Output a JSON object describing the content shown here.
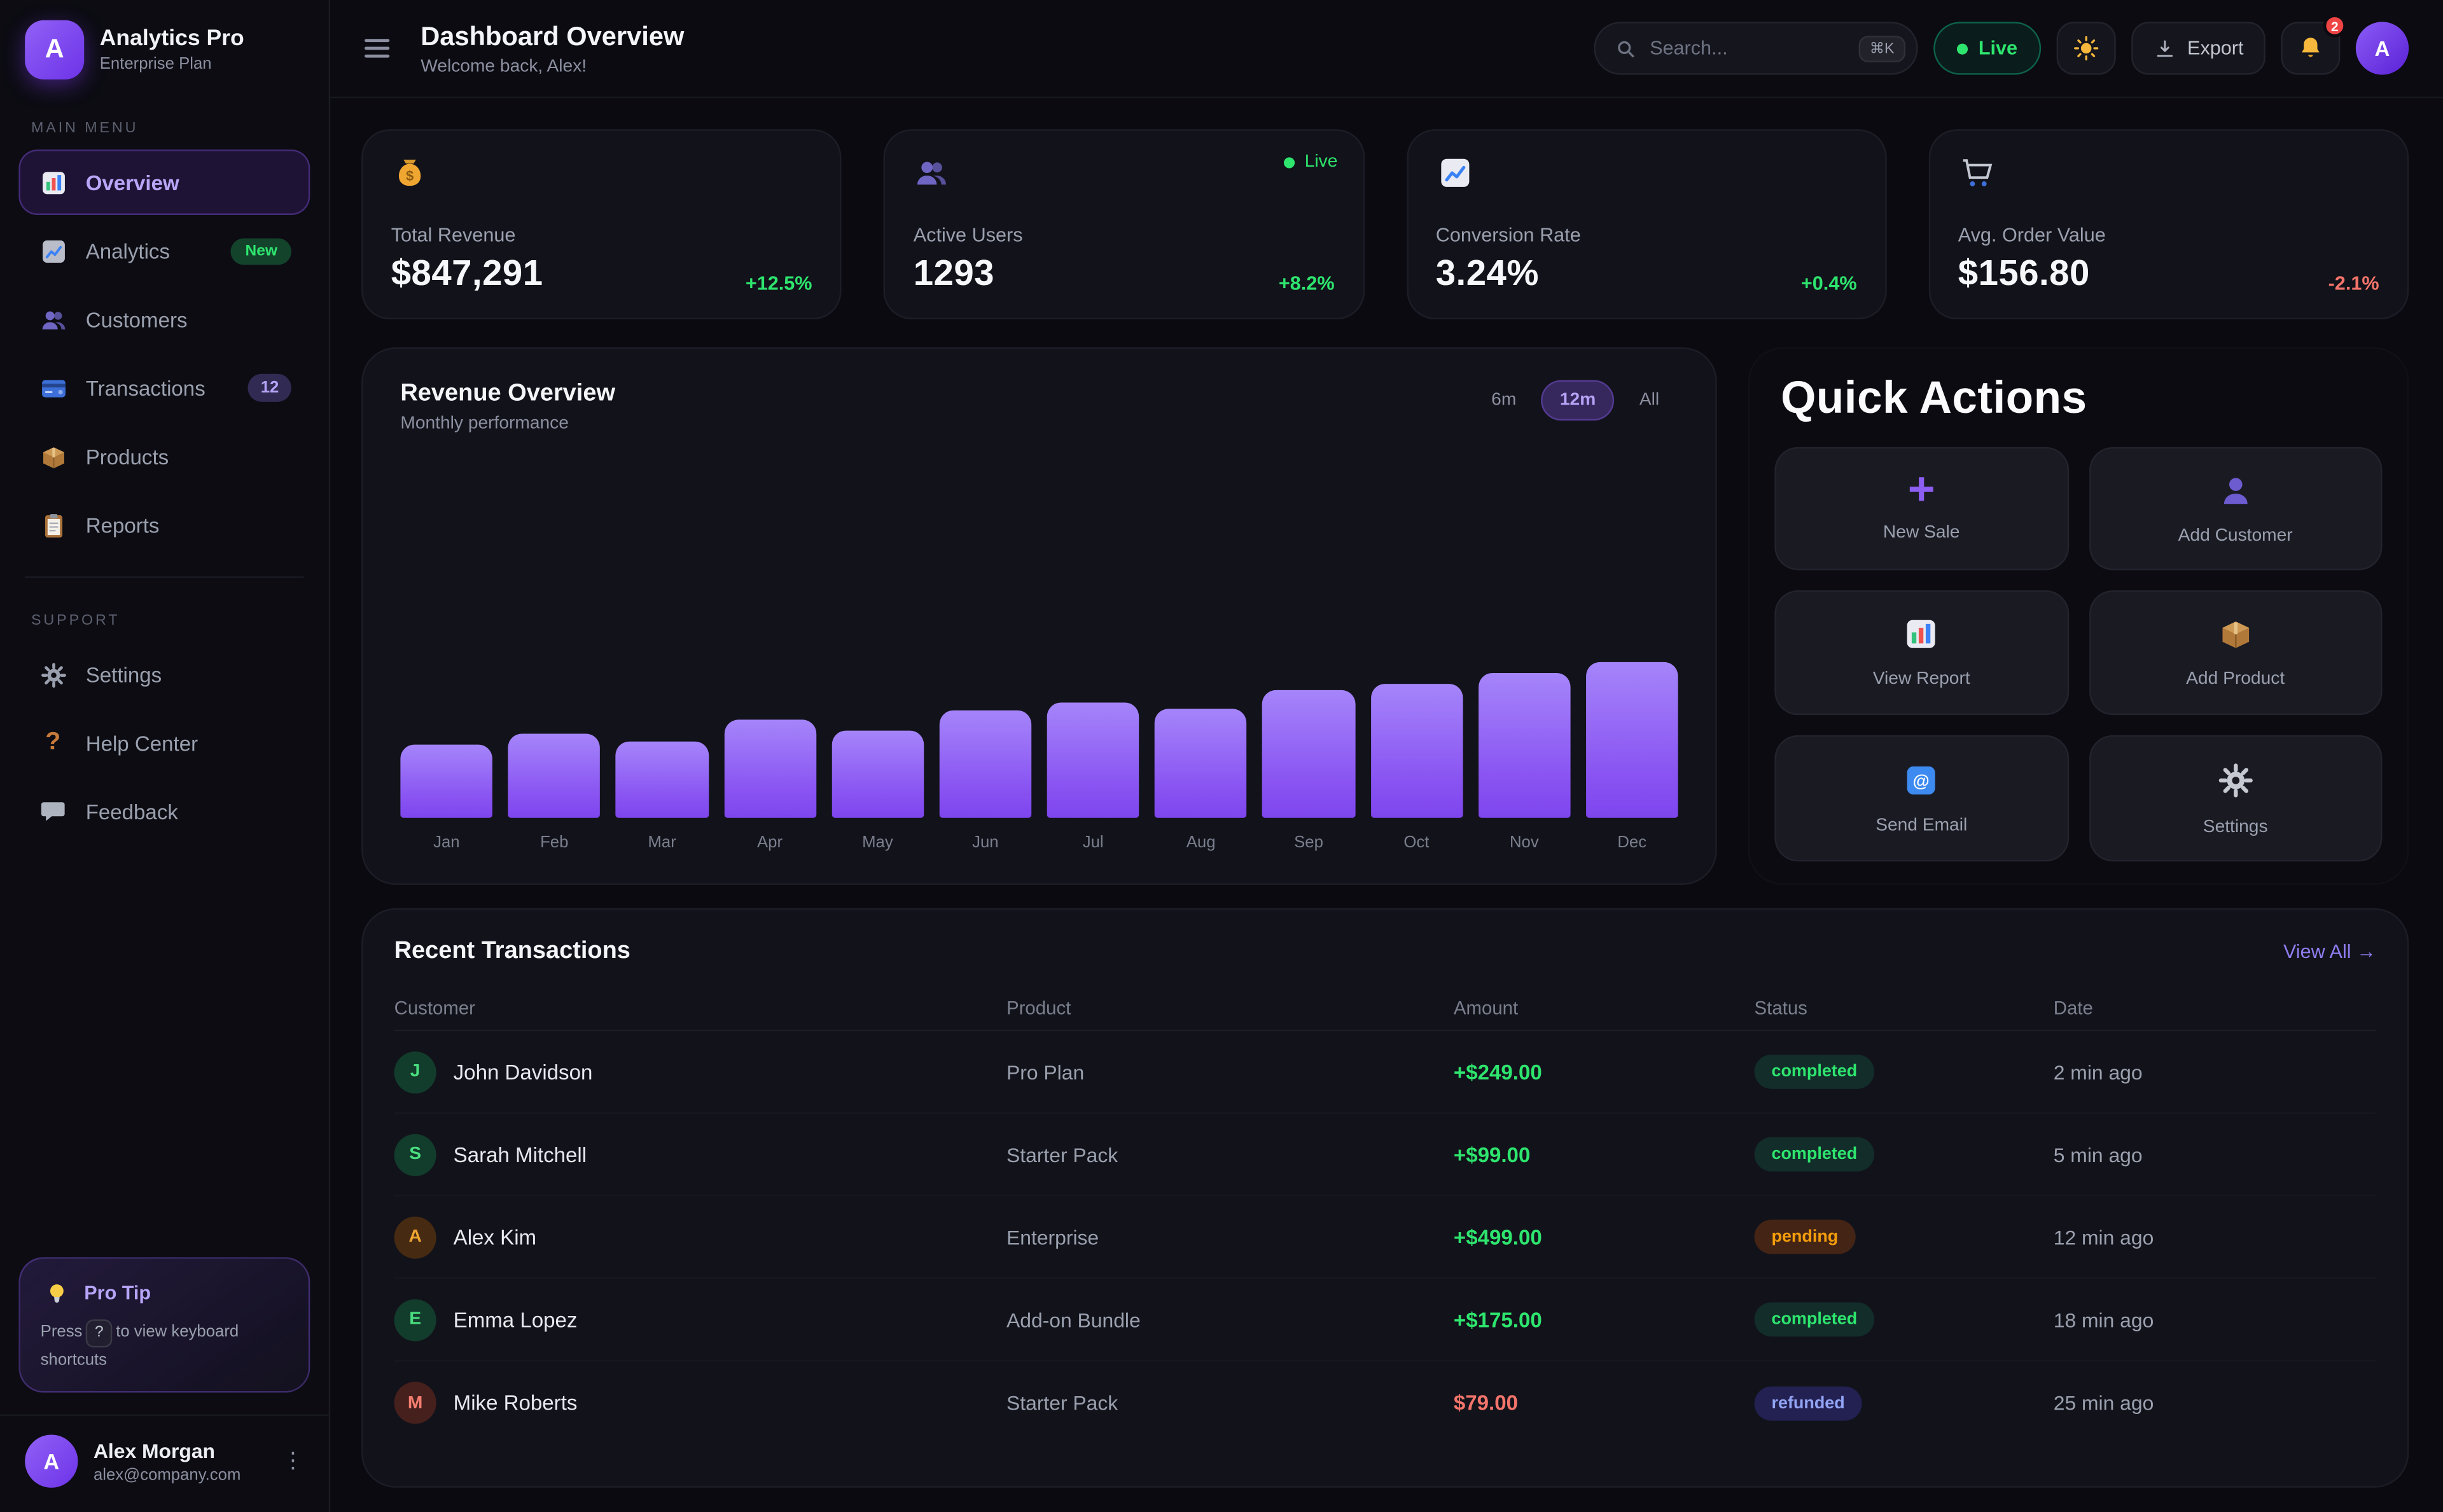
{
  "brand": {
    "initial": "A",
    "name": "Analytics Pro",
    "plan": "Enterprise Plan"
  },
  "sidebar": {
    "sections": [
      {
        "label": "MAIN MENU",
        "items": [
          {
            "label": "Overview",
            "icon": "bar-chart",
            "active": true
          },
          {
            "label": "Analytics",
            "icon": "chart-up",
            "badge": "New"
          },
          {
            "label": "Customers",
            "icon": "users"
          },
          {
            "label": "Transactions",
            "icon": "credit-card",
            "badge": "12"
          },
          {
            "label": "Products",
            "icon": "package"
          },
          {
            "label": "Reports",
            "icon": "clipboard"
          }
        ]
      },
      {
        "label": "SUPPORT",
        "items": [
          {
            "label": "Settings",
            "icon": "gear"
          },
          {
            "label": "Help Center",
            "icon": "question-mark"
          },
          {
            "label": "Feedback",
            "icon": "speech-bubble"
          }
        ]
      }
    ],
    "pro_tip": {
      "title": "Pro Tip",
      "icon": "lightbulb",
      "text_before": "Press",
      "key": "?",
      "text_after": "to view keyboard shortcuts"
    },
    "user": {
      "initial": "A",
      "name": "Alex Morgan",
      "email": "alex@company.com"
    }
  },
  "header": {
    "title": "Dashboard Overview",
    "subtitle": "Welcome back, Alex!",
    "search": {
      "placeholder": "Search...",
      "shortcut": "⌘K"
    },
    "live_label": "Live",
    "export_label": "Export",
    "notification_count": "2",
    "avatar_initial": "A"
  },
  "stats": [
    {
      "icon": "money-bag",
      "label": "Total Revenue",
      "value": "$847,291",
      "change": "+12.5%",
      "trend": "up"
    },
    {
      "icon": "users",
      "label": "Active Users",
      "value": "1293",
      "change": "+8.2%",
      "trend": "up",
      "live_badge": "Live"
    },
    {
      "icon": "chart-up",
      "label": "Conversion Rate",
      "value": "3.24%",
      "change": "+0.4%",
      "trend": "up"
    },
    {
      "icon": "cart",
      "label": "Avg. Order Value",
      "value": "$156.80",
      "change": "-2.1%",
      "trend": "down"
    }
  ],
  "revenue_panel": {
    "title": "Revenue Overview",
    "subtitle": "Monthly performance",
    "ranges": [
      {
        "label": "6m",
        "active": false
      },
      {
        "label": "12m",
        "active": true
      },
      {
        "label": "All",
        "active": false
      }
    ]
  },
  "chart_data": {
    "type": "bar",
    "title": "Revenue Overview",
    "subtitle": "Monthly performance",
    "categories": [
      "Jan",
      "Feb",
      "Mar",
      "Apr",
      "May",
      "Jun",
      "Jul",
      "Aug",
      "Sep",
      "Oct",
      "Nov",
      "Dec"
    ],
    "values": [
      47,
      54,
      49,
      63,
      56,
      69,
      74,
      70,
      82,
      86,
      93,
      100
    ],
    "units": "relative bar height %, no numeric y-axis shown",
    "xlabel": "",
    "ylabel": "",
    "grid": false,
    "legend": false,
    "bar_gradient": [
      "#a585fa",
      "#7e45ee"
    ]
  },
  "quick_actions": {
    "title": "Quick Actions",
    "items": [
      {
        "label": "New Sale",
        "icon": "plus"
      },
      {
        "label": "Add Customer",
        "icon": "person"
      },
      {
        "label": "View Report",
        "icon": "bar-chart"
      },
      {
        "label": "Add Product",
        "icon": "package"
      },
      {
        "label": "Send Email",
        "icon": "email"
      },
      {
        "label": "Settings",
        "icon": "gear"
      }
    ]
  },
  "transactions": {
    "title": "Recent Transactions",
    "view_all": "View All →",
    "columns": [
      "Customer",
      "Product",
      "Amount",
      "Status",
      "Date"
    ],
    "rows": [
      {
        "initial": "J",
        "name": "John Davidson",
        "product": "Pro Plan",
        "amount": "+$249.00",
        "status": "completed",
        "date": "2 min ago",
        "avatar_tone": "green"
      },
      {
        "initial": "S",
        "name": "Sarah Mitchell",
        "product": "Starter Pack",
        "amount": "+$99.00",
        "status": "completed",
        "date": "5 min ago",
        "avatar_tone": "green"
      },
      {
        "initial": "A",
        "name": "Alex Kim",
        "product": "Enterprise",
        "amount": "+$499.00",
        "status": "pending",
        "date": "12 min ago",
        "avatar_tone": "amber"
      },
      {
        "initial": "E",
        "name": "Emma Lopez",
        "product": "Add-on Bundle",
        "amount": "+$175.00",
        "status": "completed",
        "date": "18 min ago",
        "avatar_tone": "green"
      },
      {
        "initial": "M",
        "name": "Mike Roberts",
        "product": "Starter Pack",
        "amount": "$79.00",
        "status": "refunded",
        "date": "25 min ago",
        "avatar_tone": "red"
      }
    ]
  },
  "colors": {
    "accent": "#8b5cf6",
    "accent_light": "#b7a5f8",
    "green": "#2ee56e",
    "red": "#f4756b",
    "amber": "#f59e0b",
    "refund_blue": "#93a5f5",
    "panel_bg": "#12121a",
    "page_bg": "#0a0a10"
  }
}
